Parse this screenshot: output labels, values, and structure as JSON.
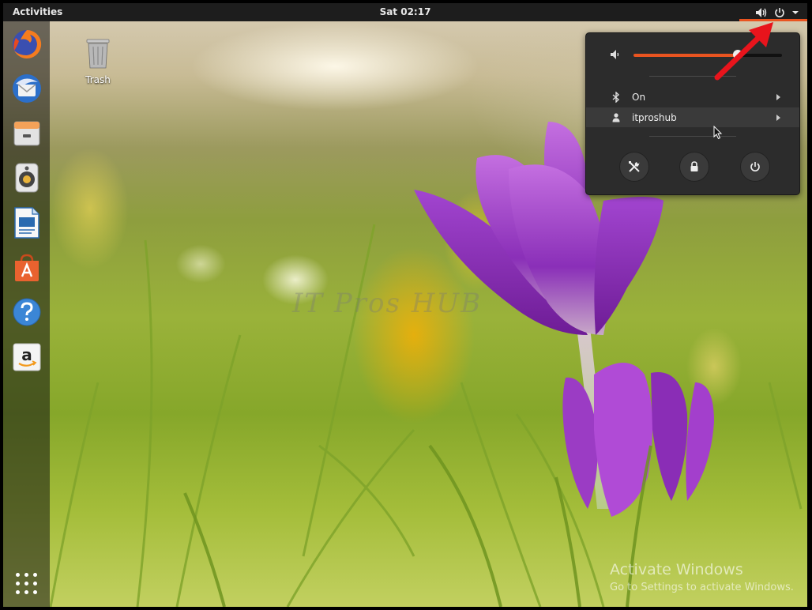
{
  "topbar": {
    "activities_label": "Activities",
    "clock": "Sat 02:17",
    "tray_icons": [
      "volume-icon",
      "power-icon",
      "dropdown-arrow-icon"
    ],
    "accent_color": "#e95420"
  },
  "dock": {
    "items": [
      "firefox-icon",
      "thunderbird-icon",
      "files-icon",
      "rhythmbox-icon",
      "libreoffice-writer-icon",
      "software-center-icon",
      "help-icon",
      "amazon-icon"
    ],
    "show_apps_icon": "grid-icon"
  },
  "desktop": {
    "trash_label": "Trash"
  },
  "system_menu": {
    "volume_fraction": 0.7,
    "bluetooth_label": "On",
    "user_label": "itproshub",
    "buttons": [
      "settings-icon",
      "lock-icon",
      "power-icon"
    ]
  },
  "watermark_text": "IT Pros HUB",
  "activation": {
    "title": "Activate Windows",
    "subtitle": "Go to Settings to activate Windows."
  }
}
